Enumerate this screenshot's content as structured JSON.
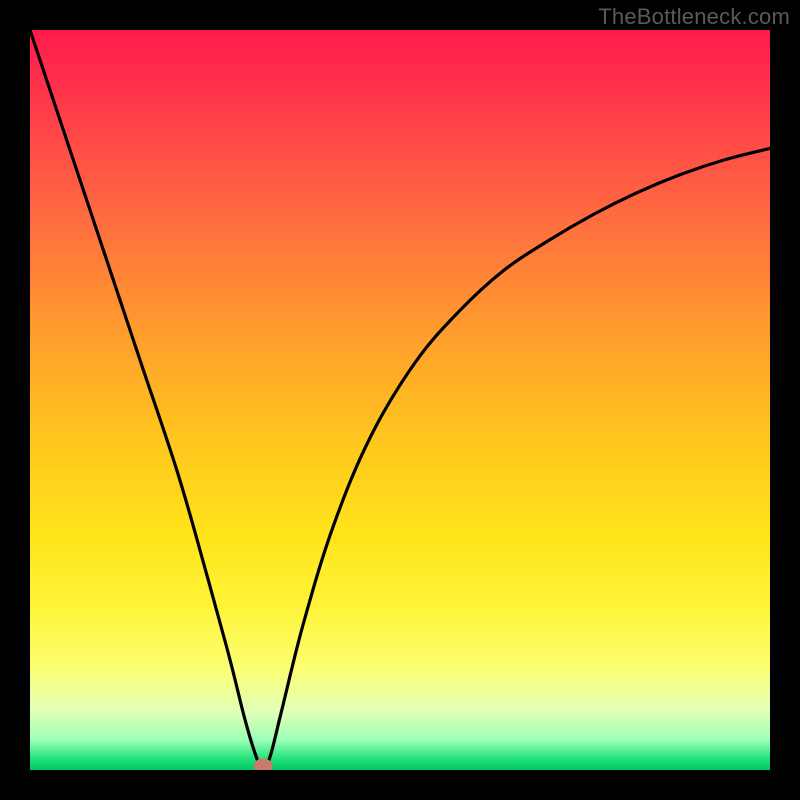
{
  "watermark": "TheBottleneck.com",
  "chart_data": {
    "type": "line",
    "title": "",
    "xlabel": "",
    "ylabel": "",
    "xlim": [
      0,
      100
    ],
    "ylim": [
      0,
      100
    ],
    "grid": false,
    "legend": false,
    "series": [
      {
        "name": "bottleneck-curve",
        "x": [
          0,
          5,
          10,
          15,
          20,
          24,
          27,
          29,
          30.5,
          31.5,
          32.5,
          34,
          37,
          41,
          46,
          52,
          58,
          64,
          70,
          76,
          82,
          88,
          94,
          100
        ],
        "y": [
          100,
          85,
          70,
          55,
          40,
          26,
          15,
          7,
          2,
          0,
          2,
          8,
          20,
          33,
          45,
          55,
          62,
          67.5,
          71.5,
          75,
          78,
          80.5,
          82.5,
          84
        ]
      }
    ],
    "marker": {
      "name": "optimal-point",
      "x": 31.5,
      "y": 0,
      "color": "#c97a6a"
    },
    "background": {
      "type": "vertical-gradient",
      "stops": [
        {
          "pos": 0.0,
          "color": "#ff1a4d"
        },
        {
          "pos": 0.55,
          "color": "#ffc51e"
        },
        {
          "pos": 0.8,
          "color": "#fff43a"
        },
        {
          "pos": 1.0,
          "color": "#00c766"
        }
      ]
    }
  }
}
